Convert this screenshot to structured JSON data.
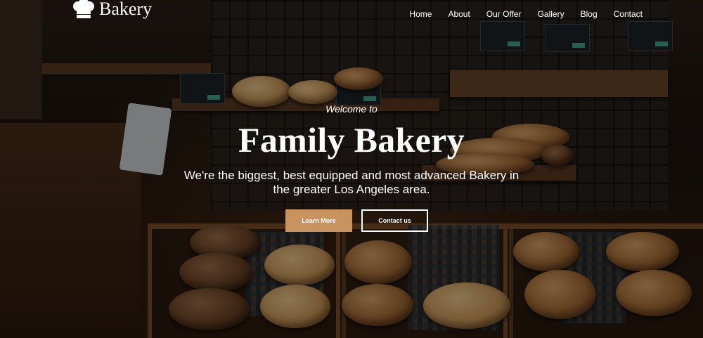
{
  "brand": {
    "name": "Bakery",
    "icon": "chef-hat-icon"
  },
  "nav": {
    "items": [
      {
        "label": "Home"
      },
      {
        "label": "About"
      },
      {
        "label": "Our Offer"
      },
      {
        "label": "Gallery"
      },
      {
        "label": "Blog"
      },
      {
        "label": "Contact"
      }
    ]
  },
  "hero": {
    "welcome": "Welcome to",
    "title": "Family Bakery",
    "description": "We're the biggest, best equipped and most advanced Bakery in the greater Los Angeles area.",
    "primary_button": "Learn More",
    "secondary_button": "Contact us"
  },
  "colors": {
    "accent": "#c9935f",
    "text": "#ffffff"
  }
}
